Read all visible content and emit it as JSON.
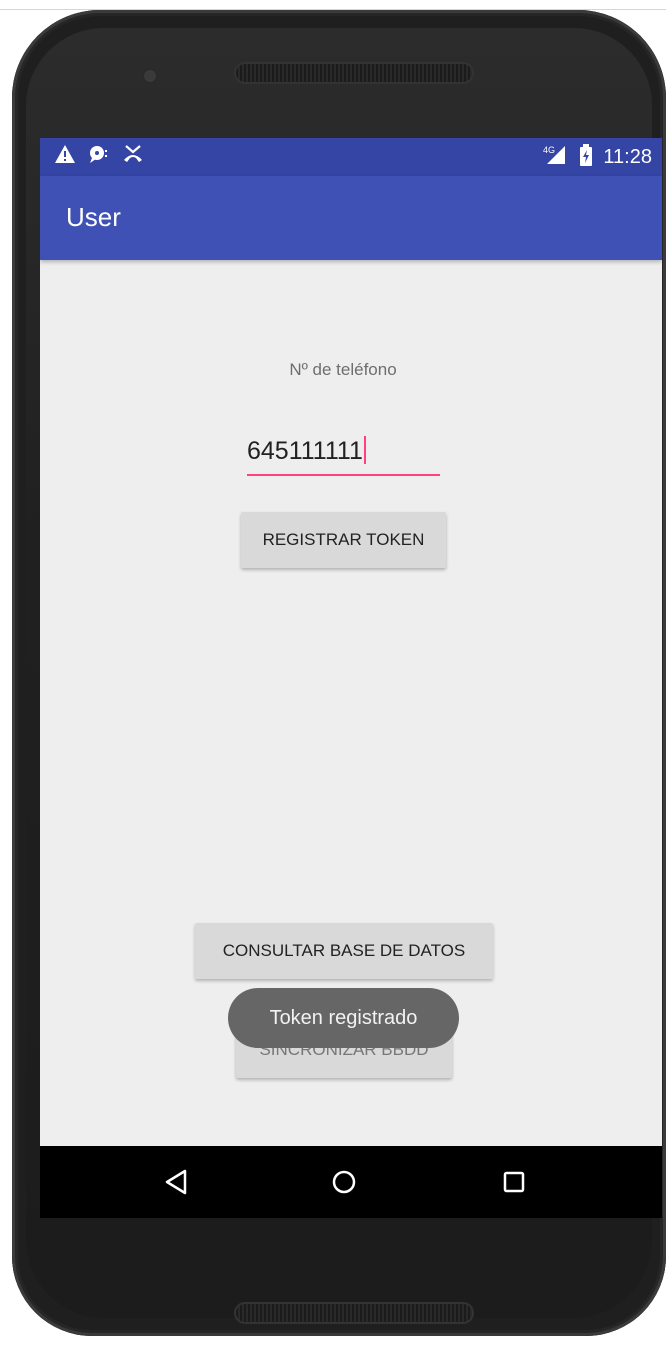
{
  "status_bar": {
    "icons_left": [
      "warning-icon",
      "chat-icon",
      "missed-call-icon"
    ],
    "icons_right": [
      "signal-icon",
      "battery-icon"
    ],
    "network": "4G",
    "time": "11:28"
  },
  "app_bar": {
    "title": "User"
  },
  "form": {
    "phone_label": "Nº de teléfono",
    "phone_value": "645111111",
    "register_button": "REGISTRAR TOKEN"
  },
  "actions": {
    "consult_button": "CONSULTAR BASE DE DATOS",
    "sync_button": "SINCRONIZAR BBDD"
  },
  "toast": {
    "message": "Token registrado"
  },
  "nav_bar": {
    "icons": [
      "back-icon",
      "home-icon",
      "recents-icon"
    ]
  },
  "colors": {
    "status_bar": "#3545a5",
    "app_bar": "#3f51b5",
    "accent": "#ff4081",
    "screen_bg": "#eeeeee"
  }
}
